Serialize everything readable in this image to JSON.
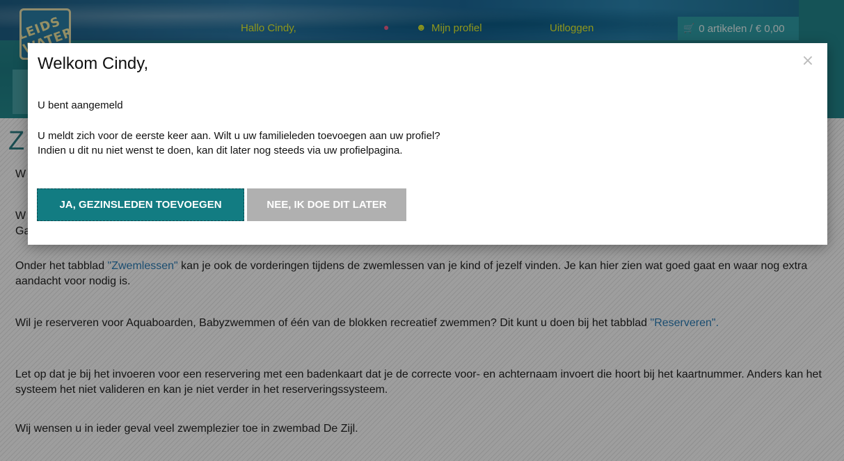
{
  "header": {
    "logo_text": "LEIDS WATER",
    "greeting": "Hallo Cindy,",
    "nav": {
      "bell_icon": "bell-icon",
      "user_icon": "user-icon",
      "profile_label": "Mijn profiel",
      "logout_label": "Uitloggen"
    },
    "cart": {
      "icon": "cart-icon",
      "label": "0 artikelen / € 0,00"
    }
  },
  "content": {
    "heading": "Z",
    "paragraphs": [
      {
        "text": "W"
      },
      {
        "text": "W"
      },
      {
        "text": "Ga"
      }
    ],
    "para_lessons": {
      "before": "Onder het tabblad ",
      "link": "\"Zwemlessen\"",
      "after": " kan je ook de vorderingen tijdens de zwemlessen van je kind of jezelf vinden. Je kan hier zien wat goed gaat en waar nog extra aandacht voor nodig is."
    },
    "para_reserve": {
      "before": "Wil je reserveren voor Aquaboarden, Babyzwemmen of één van de blokken recreatief zwemmen? Dit kunt u doen bij het tabblad ",
      "link": "\"Reserveren\"."
    },
    "para_card": "Let op dat je bij het invoeren voor een reservering met een badenkaart dat je de correcte voor- en achternaam invoert die hoort bij het kaartnummer. Anders kan het systeem het niet valideren en kan je niet verder in het reserveringssysteem.",
    "para_wish": "Wij wensen u in ieder geval veel zwemplezier toe in zwembad De Zijl."
  },
  "modal": {
    "title": "Welkom Cindy,",
    "close_icon": "close-icon",
    "close_glyph": "×",
    "status": "U bent aangemeld",
    "question": "U meldt zich voor de eerste keer aan. Wilt u uw familieleden toevoegen aan uw profiel?",
    "hint": "Indien u dit nu niet wenst te doen, kan dit later nog steeds via uw profielpagina.",
    "yes_label": "JA, GEZINSLEDEN TOEVOEGEN",
    "no_label": "NEE, IK DOE DIT LATER"
  }
}
